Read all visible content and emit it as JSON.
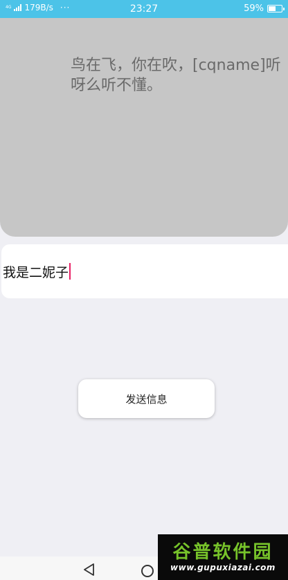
{
  "status_bar": {
    "network_type": "4G",
    "network_speed": "179B/s",
    "more_indicator": "···",
    "time": "23:27",
    "battery_percent": "59%",
    "battery_level": 0.59,
    "signal_icon": "signal-bars-icon",
    "battery_icon": "battery-icon"
  },
  "message_panel": {
    "text": "鸟在飞，你在吹，[cqname]听呀么听不懂。"
  },
  "input": {
    "value": "我是二妮子"
  },
  "send_button": {
    "label": "发送信息"
  },
  "nav_bar": {
    "back_icon": "triangle-back-icon",
    "home_icon": "circle-home-icon"
  },
  "watermark": {
    "title": "谷普软件园",
    "url": "www.gupuxiazai.com"
  },
  "colors": {
    "status_bar": "#4cc3e8",
    "panel": "#c6c6c6",
    "background": "#efeff4",
    "caret": "#e91e63",
    "watermark_green": "#77c32a"
  }
}
